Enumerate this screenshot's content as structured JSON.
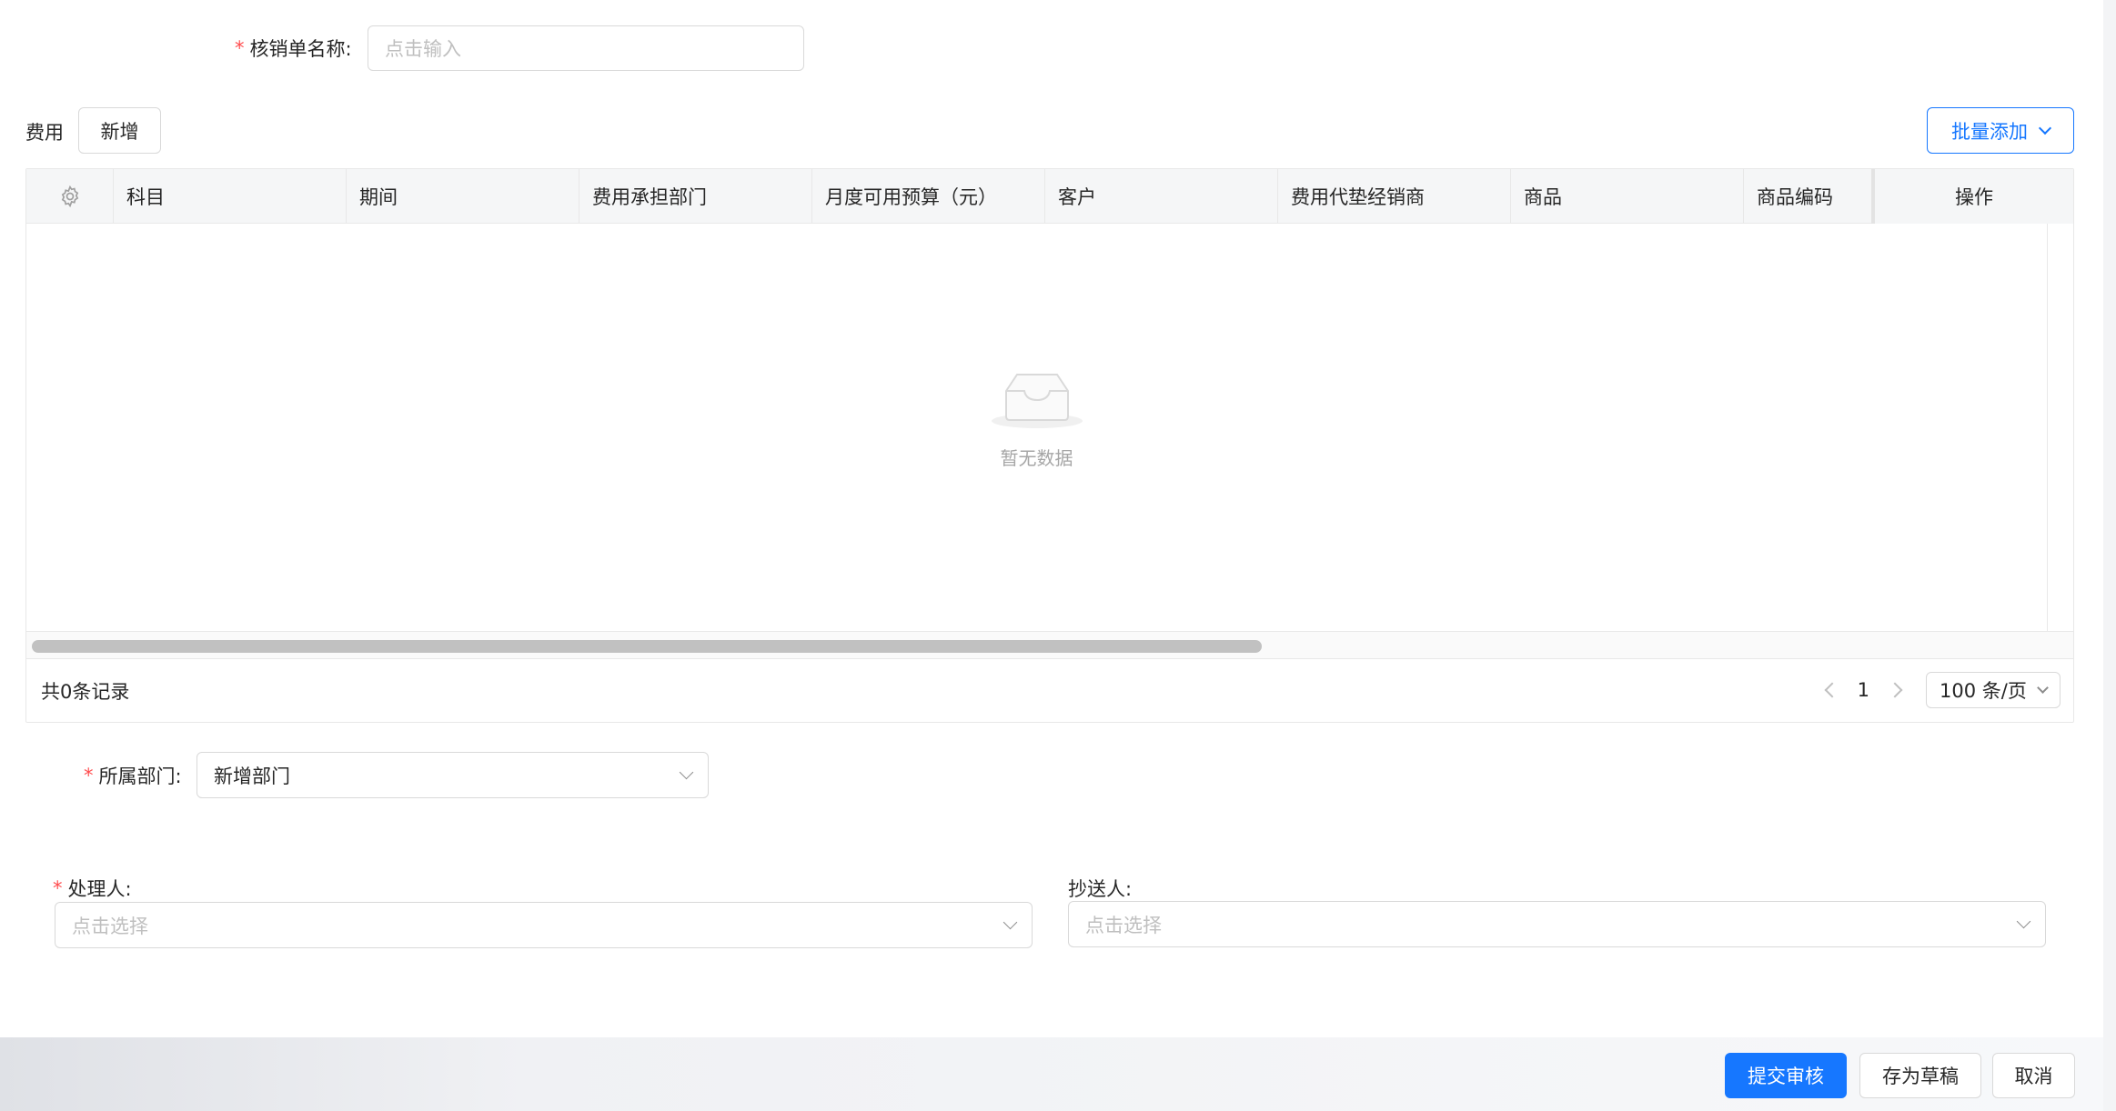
{
  "form": {
    "name_label": "核销单名称:",
    "name_placeholder": "点击输入",
    "required_mark": "*"
  },
  "fee": {
    "label": "费用",
    "add_button": "新增",
    "batch_button": "批量添加"
  },
  "table": {
    "columns": [
      "科目",
      "期间",
      "费用承担部门",
      "月度可用预算（元）",
      "客户",
      "费用代垫经销商",
      "商品",
      "商品编码"
    ],
    "action_column": "操作",
    "empty_text": "暂无数据",
    "total_text": "共0条记录",
    "page": "1",
    "page_size": "100 条/页"
  },
  "department": {
    "label": "所属部门:",
    "value": "新增部门"
  },
  "handler": {
    "label": "处理人:",
    "placeholder": "点击选择"
  },
  "cc": {
    "label": "抄送人:",
    "placeholder": "点击选择"
  },
  "actions": {
    "submit": "提交审核",
    "draft": "存为草稿",
    "cancel": "取消"
  },
  "colors": {
    "primary": "#1677ff",
    "required": "#ff4d4f"
  },
  "icons": {
    "settings": "gear-icon",
    "empty": "inbox-icon",
    "dropdown": "chevron-down-icon",
    "prev": "chevron-left-icon",
    "next": "chevron-right-icon"
  }
}
